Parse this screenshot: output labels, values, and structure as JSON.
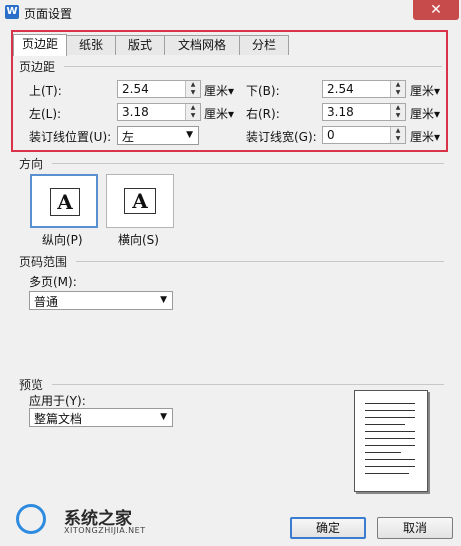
{
  "window": {
    "title": "页面设置",
    "icon_text": "W",
    "close_symbol": "✕"
  },
  "tabs": [
    {
      "label": "页边距",
      "active": true
    },
    {
      "label": "纸张",
      "active": false
    },
    {
      "label": "版式",
      "active": false
    },
    {
      "label": "文档网格",
      "active": false
    },
    {
      "label": "分栏",
      "active": false
    }
  ],
  "margins": {
    "section": "页边距",
    "top_label": "上(T):",
    "top_value": "2.54",
    "bottom_label": "下(B):",
    "bottom_value": "2.54",
    "left_label": "左(L):",
    "left_value": "3.18",
    "right_label": "右(R):",
    "right_value": "3.18",
    "unit": "厘米▾",
    "gutter_pos_label": "装订线位置(U):",
    "gutter_pos_value": "左",
    "gutter_width_label": "装订线宽(G):",
    "gutter_width_value": "0"
  },
  "orientation": {
    "section": "方向",
    "portrait_label": "纵向(P)",
    "landscape_label": "横向(S)",
    "glyph": "A"
  },
  "page_range": {
    "section": "页码范围",
    "multi_label": "多页(M):",
    "multi_value": "普通"
  },
  "preview": {
    "section": "预览",
    "apply_label": "应用于(Y):",
    "apply_value": "整篇文档"
  },
  "buttons": {
    "ok": "确定",
    "cancel": "取消"
  },
  "watermark": {
    "title": "系统之家",
    "url": "XITONGZHIJIA.NET"
  }
}
